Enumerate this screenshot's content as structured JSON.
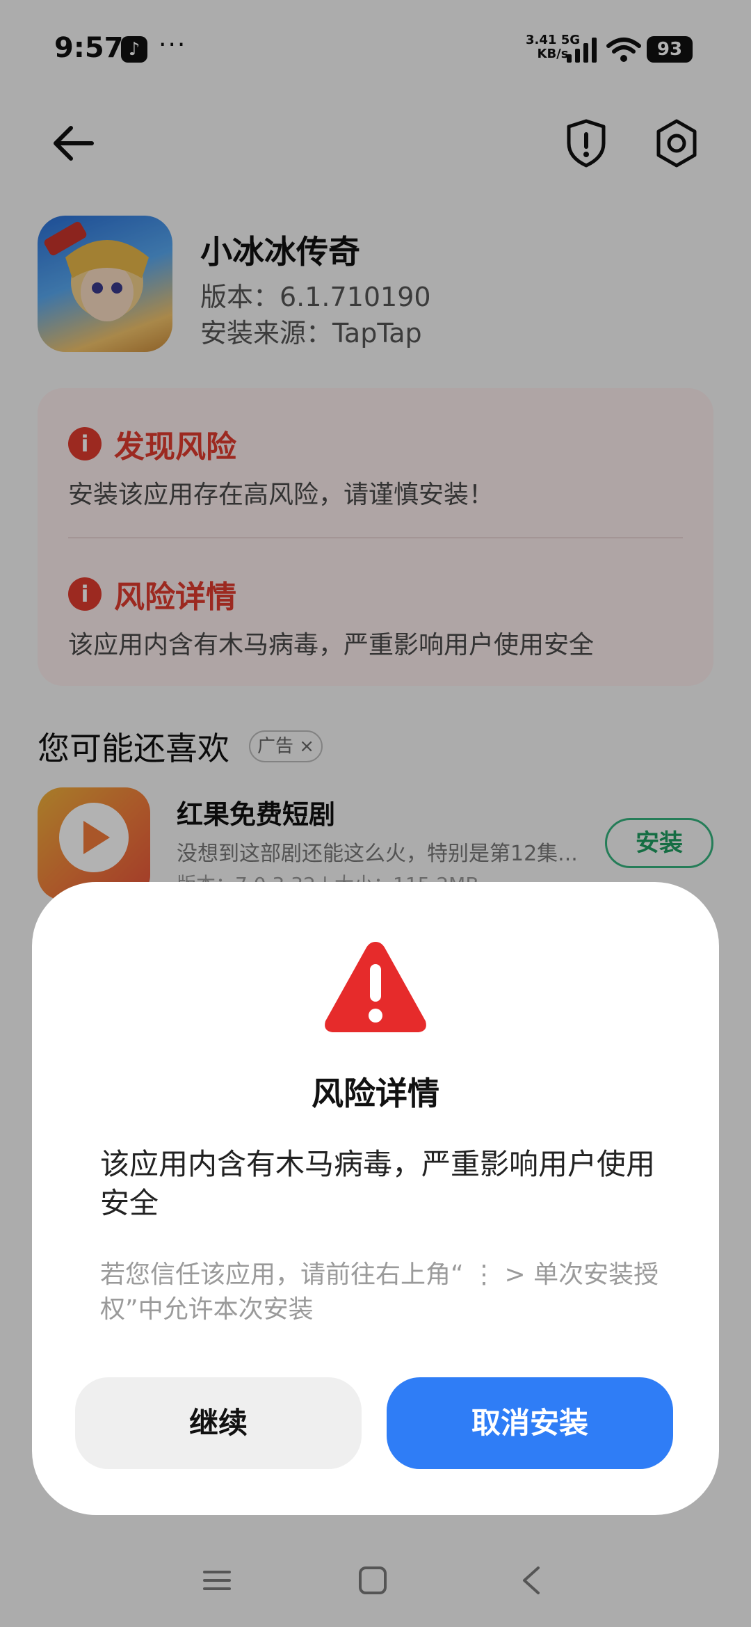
{
  "status_bar": {
    "time": "9:57",
    "more": "···",
    "net_speed_value": "3.41",
    "net_speed_unit": "KB/s",
    "net_type": "5G",
    "battery": "93"
  },
  "app": {
    "name": "小冰冰传奇",
    "version": "版本：6.1.710190",
    "source": "安装来源：TapTap"
  },
  "risk_card": {
    "found_title": "发现风险",
    "found_desc": "安装该应用存在高风险，请谨慎安装！",
    "detail_title": "风险详情",
    "detail_desc": "该应用内含有木马病毒，严重影响用户使用安全"
  },
  "recommend": {
    "title": "您可能还喜欢",
    "ad_label": "广告",
    "item": {
      "name": "红果免费短剧",
      "desc": "没想到这部剧还能这么火，特别是第12集...",
      "meta": "版本：7.0.3.32 | 大小：115.2MB",
      "install_label": "安装"
    }
  },
  "dialog": {
    "title": "风险详情",
    "message": "该应用内含有木马病毒，严重影响用户使用安全",
    "hint": "若您信任该应用，请前往右上角“ ⋮ > 单次安装授权”中允许本次安装",
    "continue_label": "继续",
    "cancel_label": "取消安装"
  },
  "colors": {
    "danger": "#e03c2f",
    "primary": "#2f7df6",
    "install_green": "#36b37e"
  }
}
